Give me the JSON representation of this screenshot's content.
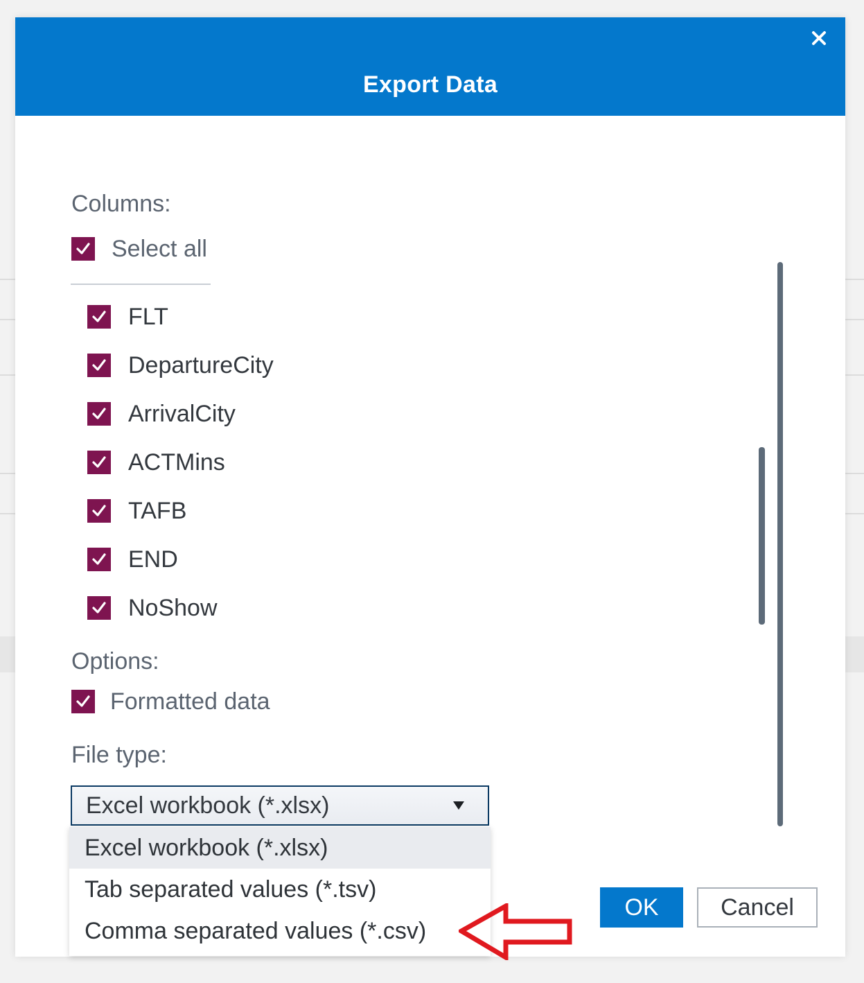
{
  "dialog": {
    "title": "Export Data",
    "close_icon": "close-icon"
  },
  "columns": {
    "label": "Columns:",
    "select_all": {
      "label": "Select all",
      "checked": true
    },
    "items": [
      {
        "label": "FLT",
        "checked": true
      },
      {
        "label": "DepartureCity",
        "checked": true
      },
      {
        "label": "ArrivalCity",
        "checked": true
      },
      {
        "label": "ACTMins",
        "checked": true
      },
      {
        "label": "TAFB",
        "checked": true
      },
      {
        "label": "END",
        "checked": true
      },
      {
        "label": "NoShow",
        "checked": true
      }
    ]
  },
  "options": {
    "label": "Options:",
    "formatted_data": {
      "label": "Formatted data",
      "checked": true
    }
  },
  "file_type": {
    "label": "File type:",
    "selected": "Excel workbook (*.xlsx)",
    "options": [
      "Excel workbook (*.xlsx)",
      "Tab separated values (*.tsv)",
      "Comma separated values (*.csv)"
    ]
  },
  "buttons": {
    "ok": "OK",
    "cancel": "Cancel"
  },
  "colors": {
    "header": "#0478cc",
    "checkbox": "#7e1450",
    "annotation_arrow": "#e0191f"
  }
}
